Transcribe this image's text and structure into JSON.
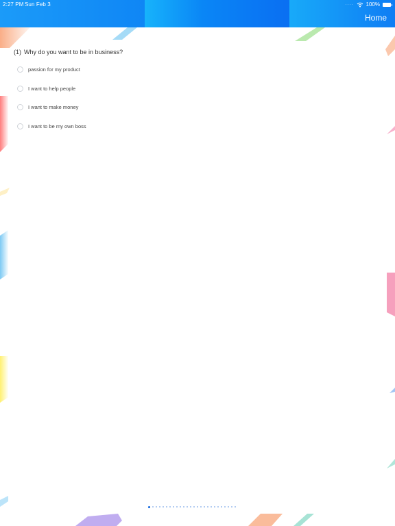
{
  "status_bar": {
    "time": "2:27 PM",
    "date": "Sun Feb 3",
    "battery": "100%",
    "icons": [
      "wifi-icon",
      "battery-icon"
    ]
  },
  "nav": {
    "home_label": "Home"
  },
  "question": {
    "number": "(1)",
    "text": "Why do you want to be in business?",
    "options": [
      "passion for my product",
      "I want to help people",
      "I want to make money",
      "I want to be my own boss"
    ]
  },
  "pager": {
    "total": 26,
    "current": 1
  },
  "colors": {
    "header_blue": "#0b74f3",
    "radio_border": "#cfd3d8",
    "pager_active": "#1f6fe0"
  }
}
